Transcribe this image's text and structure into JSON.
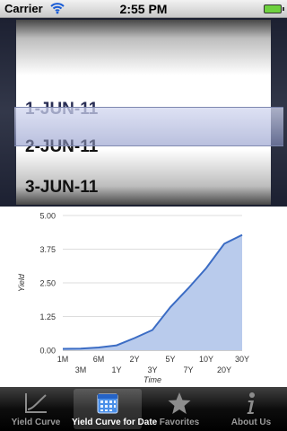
{
  "status_bar": {
    "carrier": "Carrier",
    "time": "2:55 PM"
  },
  "picker": {
    "rows": [
      "1-JUN-11",
      "2-JUN-11",
      "3-JUN-11"
    ],
    "selected": "1-JUN-11"
  },
  "chart_data": {
    "type": "area",
    "categories": [
      "1M",
      "3M",
      "6M",
      "1Y",
      "2Y",
      "3Y",
      "5Y",
      "7Y",
      "10Y",
      "20Y",
      "30Y"
    ],
    "values": [
      0.05,
      0.06,
      0.1,
      0.18,
      0.45,
      0.75,
      1.6,
      2.3,
      3.05,
      3.95,
      4.28
    ],
    "xlabel": "Time",
    "ylabel": "Yield",
    "ylim": [
      0,
      5
    ],
    "yticks": [
      "0.00",
      "1.25",
      "2.50",
      "3.75",
      "5.00"
    ],
    "grid": true,
    "colors": {
      "line": "#3b6cc4",
      "fill": "#b9cbec"
    }
  },
  "tab_bar": {
    "items": [
      {
        "label": "Yield Curve",
        "icon": "chart-line-icon"
      },
      {
        "label": "Yield Curve for Date",
        "icon": "calendar-icon"
      },
      {
        "label": "Favorites",
        "icon": "star-icon"
      },
      {
        "label": "About Us",
        "icon": "info-icon"
      }
    ],
    "active_index": 1
  }
}
